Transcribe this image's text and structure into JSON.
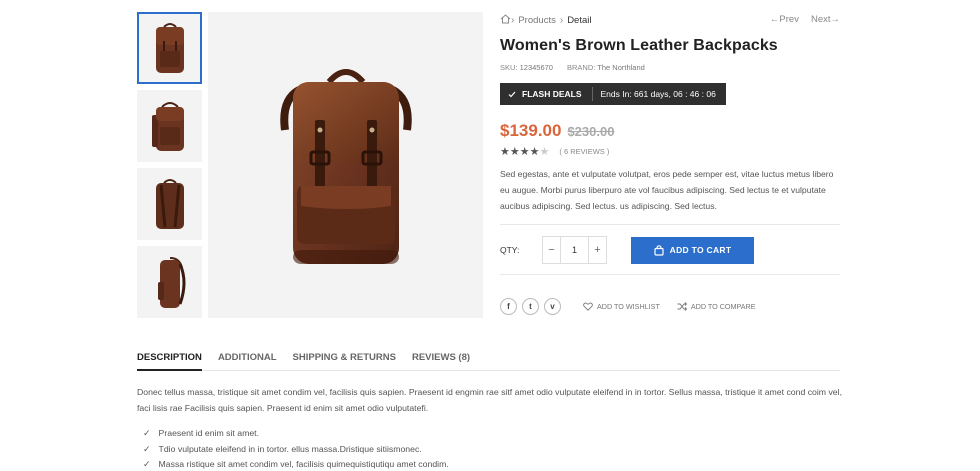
{
  "thumbnails": [
    {
      "alt": "backpack-front"
    },
    {
      "alt": "backpack-angle"
    },
    {
      "alt": "backpack-back"
    },
    {
      "alt": "backpack-side"
    }
  ],
  "breadcrumb": {
    "home_icon": "home-icon",
    "items": [
      "Products",
      "Detail"
    ]
  },
  "pager": {
    "prev": "←Prev",
    "next": "Next→"
  },
  "product": {
    "title": "Women's Brown Leather Backpacks",
    "sku_label": "SKU:",
    "sku": "12345670",
    "brand_label": "BRAND:",
    "brand": "The Northland",
    "flash_label": "FLASH DEALS",
    "countdown": "Ends In: 661 days, 06 : 46 : 06",
    "price": "$139.00",
    "old_price": "$230.00",
    "rating": 4,
    "rating_max": 5,
    "reviews": "( 6 REVIEWS )",
    "description": "Sed egestas, ante et vulputate volutpat, eros pede semper est, vitae luctus metus libero eu augue. Morbi purus liberpuro ate vol faucibus adipiscing. Sed lectus te et vulputate aucibus adipiscing. Sed lectus. us adipiscing. Sed lectus."
  },
  "purchase": {
    "qty_label": "QTY:",
    "quantity": "1",
    "minus": "−",
    "plus": "+",
    "add_to_cart": "ADD TO CART"
  },
  "share": {
    "facebook": "f",
    "twitter": "t",
    "vimeo": "v",
    "wishlist": "ADD TO WISHLIST",
    "compare": "ADD TO COMPARE"
  },
  "tabs": [
    "DESCRIPTION",
    "ADDITIONAL",
    "SHIPPING & RETURNS",
    "REVIEWS (8)"
  ],
  "active_tab": "DESCRIPTION",
  "tab_content": {
    "paragraph": "Donec tellus massa, tristique sit amet condim vel, facilisis quis sapien. Praesent id engmin rae sitf amet odio vulputate eleifend in in tortor. Sellus massa, tristique it amet cond coim vel, faci lisis rae Facilisis quis sapien. Praesent id enim sit amet odio vulputatefi.",
    "features": [
      "Praesent id enim sit amet.",
      "Tdio vulputate eleifend in in tortor. ellus massa.Dristique sitiismonec.",
      "Massa ristique sit amet condim vel, facilisis quimequistiqutiqu amet condim."
    ]
  },
  "colors": {
    "accent": "#2c6ecb",
    "price": "#d9653b",
    "flash_bg": "#2f2f2f",
    "leather": "#6b3420"
  }
}
